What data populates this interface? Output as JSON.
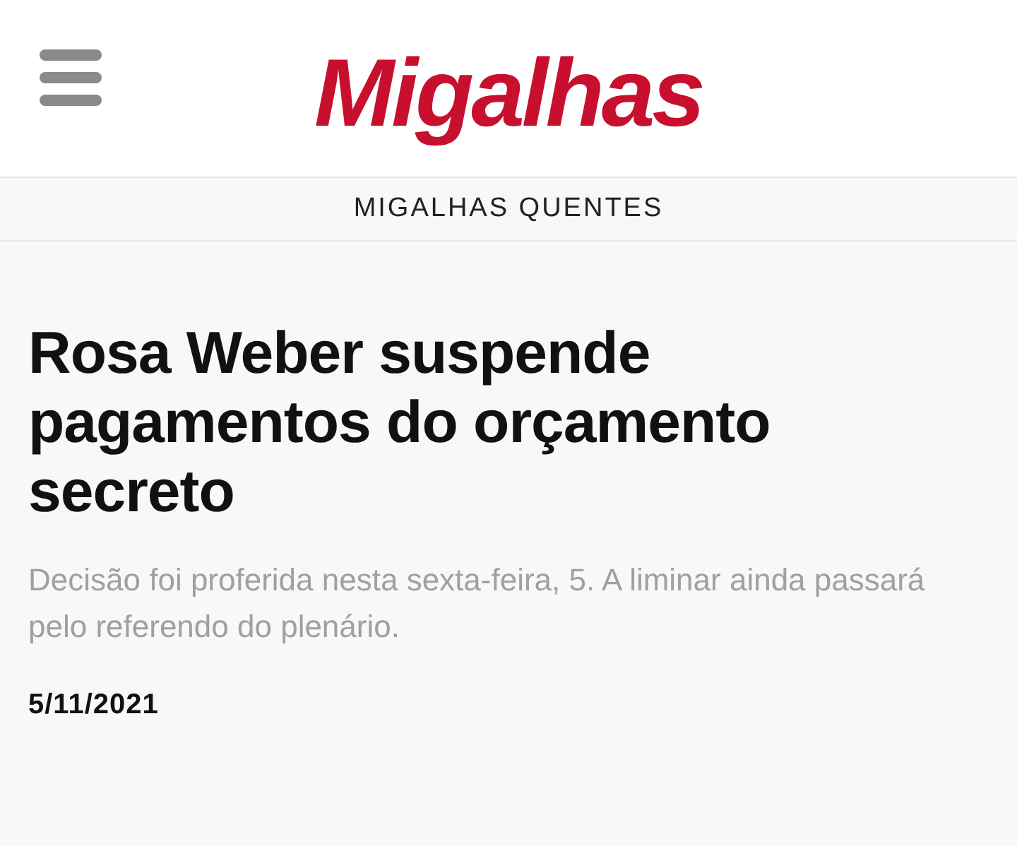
{
  "header": {
    "logo": "Migalhas"
  },
  "section": {
    "label": "MIGALHAS QUENTES"
  },
  "article": {
    "title": "Rosa Weber suspende pagamentos do orçamento secreto",
    "summary": "Decisão foi proferida nesta sexta-feira, 5. A liminar ainda passará pelo referendo do plenário.",
    "date": "5/11/2021"
  }
}
